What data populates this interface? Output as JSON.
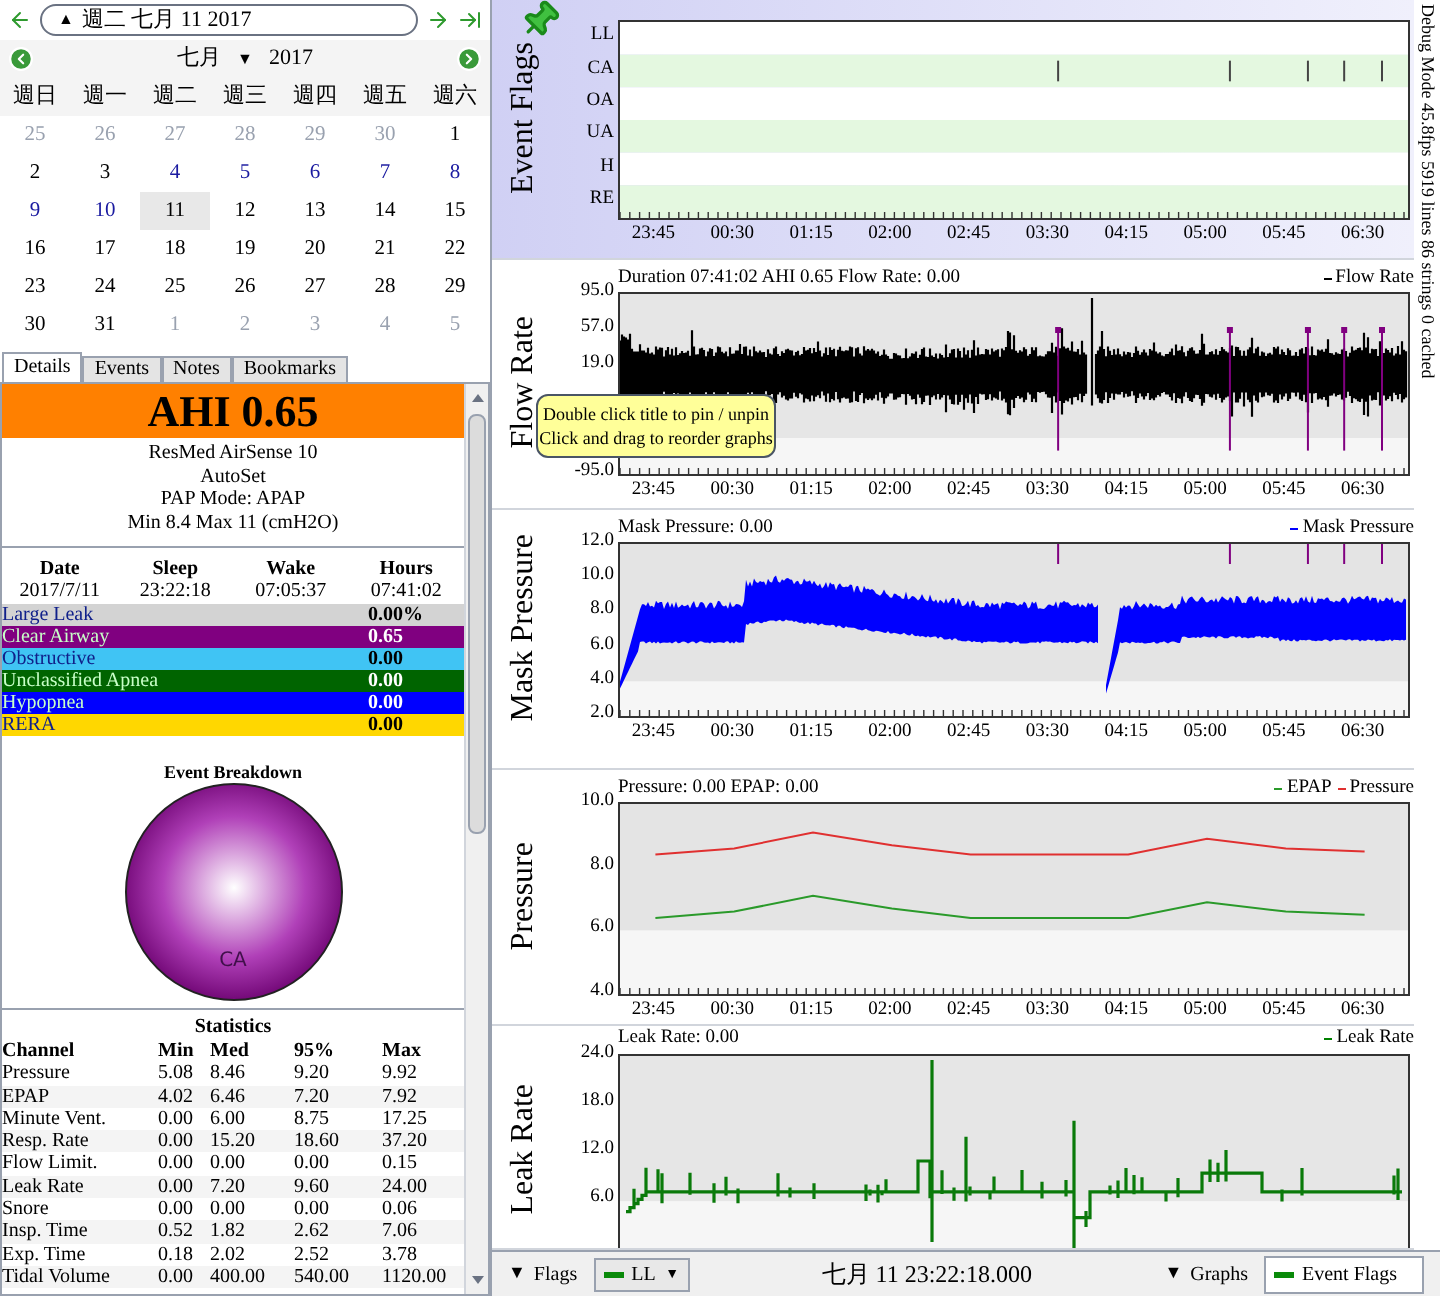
{
  "date_bar": {
    "caret": "▲",
    "text": "週二 七月 11 2017"
  },
  "calendar": {
    "month": "七月",
    "month_caret": "▼",
    "year": "2017",
    "weekdays": [
      "週日",
      "週一",
      "週二",
      "週三",
      "週四",
      "週五",
      "週六"
    ],
    "days": [
      {
        "label": "25",
        "kind": "other",
        "selected": false
      },
      {
        "label": "26",
        "kind": "other",
        "selected": false
      },
      {
        "label": "27",
        "kind": "other",
        "selected": false
      },
      {
        "label": "28",
        "kind": "other",
        "selected": false
      },
      {
        "label": "29",
        "kind": "other",
        "selected": false
      },
      {
        "label": "30",
        "kind": "other",
        "selected": false
      },
      {
        "label": "1",
        "kind": "normal",
        "selected": false
      },
      {
        "label": "2",
        "kind": "normal",
        "selected": false
      },
      {
        "label": "3",
        "kind": "normal",
        "selected": false
      },
      {
        "label": "4",
        "kind": "data",
        "selected": false
      },
      {
        "label": "5",
        "kind": "data",
        "selected": false
      },
      {
        "label": "6",
        "kind": "data",
        "selected": false
      },
      {
        "label": "7",
        "kind": "data",
        "selected": false
      },
      {
        "label": "8",
        "kind": "data",
        "selected": false
      },
      {
        "label": "9",
        "kind": "data",
        "selected": false
      },
      {
        "label": "10",
        "kind": "data",
        "selected": false
      },
      {
        "label": "11",
        "kind": "normal",
        "selected": true
      },
      {
        "label": "12",
        "kind": "normal",
        "selected": false
      },
      {
        "label": "13",
        "kind": "normal",
        "selected": false
      },
      {
        "label": "14",
        "kind": "normal",
        "selected": false
      },
      {
        "label": "15",
        "kind": "normal",
        "selected": false
      },
      {
        "label": "16",
        "kind": "normal",
        "selected": false
      },
      {
        "label": "17",
        "kind": "normal",
        "selected": false
      },
      {
        "label": "18",
        "kind": "normal",
        "selected": false
      },
      {
        "label": "19",
        "kind": "normal",
        "selected": false
      },
      {
        "label": "20",
        "kind": "normal",
        "selected": false
      },
      {
        "label": "21",
        "kind": "normal",
        "selected": false
      },
      {
        "label": "22",
        "kind": "normal",
        "selected": false
      },
      {
        "label": "23",
        "kind": "normal",
        "selected": false
      },
      {
        "label": "24",
        "kind": "normal",
        "selected": false
      },
      {
        "label": "25",
        "kind": "normal",
        "selected": false
      },
      {
        "label": "26",
        "kind": "normal",
        "selected": false
      },
      {
        "label": "27",
        "kind": "normal",
        "selected": false
      },
      {
        "label": "28",
        "kind": "normal",
        "selected": false
      },
      {
        "label": "29",
        "kind": "normal",
        "selected": false
      },
      {
        "label": "30",
        "kind": "normal",
        "selected": false
      },
      {
        "label": "31",
        "kind": "normal",
        "selected": false
      },
      {
        "label": "1",
        "kind": "other",
        "selected": false
      },
      {
        "label": "2",
        "kind": "other",
        "selected": false
      },
      {
        "label": "3",
        "kind": "other",
        "selected": false
      },
      {
        "label": "4",
        "kind": "other",
        "selected": false
      },
      {
        "label": "5",
        "kind": "other",
        "selected": false
      }
    ]
  },
  "tabs": [
    {
      "label": "Details",
      "selected": true
    },
    {
      "label": "Events",
      "selected": false
    },
    {
      "label": "Notes",
      "selected": false
    },
    {
      "label": "Bookmarks",
      "selected": false
    }
  ],
  "details": {
    "ahi": "AHI 0.65",
    "device_lines": [
      "ResMed AirSense 10",
      "AutoSet",
      "PAP Mode: APAP",
      "Min 8.4 Max 11 (cmH2O)"
    ],
    "summary": {
      "columns": [
        "Date",
        "Sleep",
        "Wake",
        "Hours"
      ],
      "values": [
        "2017/7/11",
        "23:22:18",
        "07:05:37",
        "07:41:02"
      ]
    },
    "events": [
      {
        "name": "Large Leak",
        "value": "0.00%",
        "color": "#d3d3d3"
      },
      {
        "name": "Clear Airway",
        "value": "0.65",
        "color": "#800080"
      },
      {
        "name": "Obstructive",
        "value": "0.00",
        "color": "#40c4f4"
      },
      {
        "name": "Unclassified Apnea",
        "value": "0.00",
        "color": "#006400"
      },
      {
        "name": "Hypopnea",
        "value": "0.00",
        "color": "#0000ff"
      },
      {
        "name": "RERA",
        "value": "0.00",
        "color": "#ffd700"
      }
    ],
    "breakdown_title": "Event Breakdown",
    "breakdown_label": "CA",
    "statistics": {
      "title": "Statistics",
      "columns": [
        "Channel",
        "Min",
        "Med",
        "95%",
        "Max"
      ],
      "rows": [
        [
          "Pressure",
          "5.08",
          "8.46",
          "9.20",
          "9.92"
        ],
        [
          "EPAP",
          "4.02",
          "6.46",
          "7.20",
          "7.92"
        ],
        [
          "Minute Vent.",
          "0.00",
          "6.00",
          "8.75",
          "17.25"
        ],
        [
          "Resp. Rate",
          "0.00",
          "15.20",
          "18.60",
          "37.20"
        ],
        [
          "Flow Limit.",
          "0.00",
          "0.00",
          "0.00",
          "0.15"
        ],
        [
          "Leak Rate",
          "0.00",
          "7.20",
          "9.60",
          "24.00"
        ],
        [
          "Snore",
          "0.00",
          "0.00",
          "0.00",
          "0.06"
        ],
        [
          "Insp. Time",
          "0.52",
          "1.82",
          "2.62",
          "7.06"
        ],
        [
          "Exp. Time",
          "0.18",
          "2.02",
          "2.52",
          "3.78"
        ],
        [
          "Tidal Volume",
          "0.00",
          "400.00",
          "540.00",
          "1120.00"
        ]
      ]
    }
  },
  "graphs": [
    {
      "kind": "flags",
      "title": "Event Flags",
      "y_labels": [
        "LL",
        "CA",
        "OA",
        "UA",
        "H",
        "RE"
      ],
      "x_ticks": [
        "23:45",
        "00:30",
        "01:15",
        "02:00",
        "02:45",
        "03:30",
        "04:15",
        "05:00",
        "05:45",
        "06:30"
      ]
    },
    {
      "kind": "flow",
      "title": "Flow Rate",
      "header": "Duration 07:41:02 AHI 0.65 Flow Rate: 0.00",
      "legend": [
        {
          "label": "Flow Rate",
          "color": "#000000"
        }
      ],
      "y_labels": [
        "95.0",
        "57.0",
        "19.0",
        "-95.0"
      ],
      "x_ticks": [
        "23:45",
        "00:30",
        "01:15",
        "02:00",
        "02:45",
        "03:30",
        "04:15",
        "05:00",
        "05:45",
        "06:30"
      ],
      "tooltip": [
        "Double click title to pin / unpin",
        "Click and drag to reorder graphs"
      ]
    },
    {
      "kind": "mask",
      "title": "Mask Pressure",
      "header": "Mask Pressure: 0.00",
      "legend": [
        {
          "label": "Mask Pressure",
          "color": "#0000ff"
        }
      ],
      "y_labels": [
        "12.0",
        "10.0",
        "8.0",
        "6.0",
        "4.0",
        "2.0"
      ],
      "x_ticks": [
        "23:45",
        "00:30",
        "01:15",
        "02:00",
        "02:45",
        "03:30",
        "04:15",
        "05:00",
        "05:45",
        "06:30"
      ]
    },
    {
      "kind": "pressure",
      "title": "Pressure",
      "header": "Pressure: 0.00 EPAP: 0.00",
      "chart_data": {
        "type": "line",
        "legend": "top right",
        "bands": [
          {
            "axis": "y",
            "from": 6,
            "to": 10,
            "color": "#e4e4e4"
          },
          {
            "axis": "y",
            "from": 4,
            "to": 6,
            "color": "#f6f6f6"
          }
        ],
        "categories": [
          "23:45",
          "00:30",
          "01:15",
          "02:00",
          "02:45",
          "03:30",
          "04:15",
          "05:00",
          "05:45",
          "06:30"
        ],
        "ylim": [
          4,
          10
        ],
        "yticks": [
          {
            "value": 10,
            "label": "10.0"
          },
          {
            "value": 8,
            "label": "8.0"
          },
          {
            "value": 6,
            "label": "6.0"
          },
          {
            "value": 4,
            "label": "4.0"
          }
        ],
        "series": [
          {
            "name": "EPAP",
            "color": "#2a9a2a",
            "values": [
              6.4,
              6.6,
              7.1,
              6.7,
              6.4,
              6.4,
              6.4,
              6.9,
              6.6,
              6.5
            ]
          },
          {
            "name": "Pressure",
            "color": "#e03030",
            "values": [
              8.4,
              8.6,
              9.1,
              8.7,
              8.4,
              8.4,
              8.4,
              8.9,
              8.6,
              8.5
            ]
          }
        ]
      }
    },
    {
      "kind": "leak",
      "title": "Leak Rate",
      "header": "Leak Rate: 0.00",
      "legend": [
        {
          "label": "Leak Rate",
          "color": "#008000"
        }
      ],
      "y_labels": [
        "24.0",
        "18.0",
        "12.0",
        "6.0"
      ]
    }
  ],
  "debug": "Debug Mode 45.8fps 5919 lines 86 strings 0 cached",
  "bottom_bar": {
    "flags_caret": "▼",
    "flags_button": "Flags",
    "flags_combo": "LL",
    "combo_caret": "▼",
    "date": "七月 11 23:22:18.000",
    "graphs_caret": "▼",
    "graphs_button": "Graphs",
    "graphs_combo": "Event Flags"
  }
}
